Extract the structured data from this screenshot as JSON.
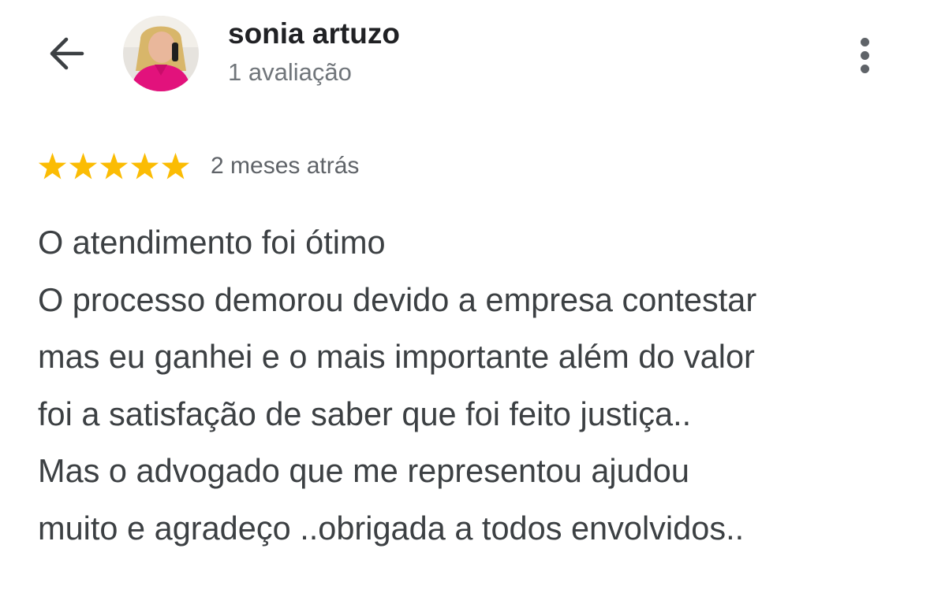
{
  "header": {
    "reviewer_name": "sonia artuzo",
    "review_count": "1 avaliação",
    "back_icon": "arrow-back-icon",
    "menu_icon": "more-vert-icon"
  },
  "review": {
    "rating": 5,
    "max_rating": 5,
    "star_color": "#fbbc04",
    "time_ago": "2 meses atrás",
    "lines": [
      "O atendimento foi ótimo",
      "O processo demorou devido a empresa contestar",
      "mas eu ganhei e o mais importante além do valor",
      "foi a satisfação de saber que foi feito justiça..",
      "Mas o advogado que me representou ajudou",
      "muito e agradeço ..obrigada a todos envolvidos.."
    ]
  }
}
